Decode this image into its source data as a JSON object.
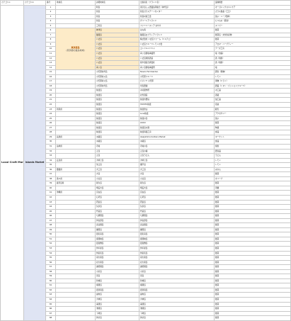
{
  "headers": [
    "カテゴリ①",
    "カテゴリ②",
    "番号",
    "地域名",
    "詳細地域名",
    "出展者名（ブランド名）",
    "業種概要"
  ],
  "category1": "Local Craft Market",
  "category2": "Islands Market",
  "highlight": {
    "title": "東京都島",
    "subtitle": "(東京都の離島地域)"
  },
  "rows": [
    {
      "num": "1",
      "region": "",
      "detail": "利島",
      "name": "東京島しょ農業協同組合（神代島）",
      "desc": "オーガニックスキンケア"
    },
    {
      "num": "2",
      "region": "",
      "detail": "新島",
      "name": "新島ガラスアートセンター",
      "desc": "ガラス製品（工芸）"
    },
    {
      "num": "3",
      "region": "",
      "detail": "新島",
      "name": "新島村商工会",
      "desc": "菓子・ハーブ飲料"
    },
    {
      "num": "4",
      "region": "",
      "detail": "新島",
      "name": "グリーンアイランド",
      "desc": "たべもの（農産）"
    },
    {
      "num": "5",
      "region": "",
      "detail": "三宅島",
      "name": "ファミリーストア みやけ",
      "desc": "スーパー"
    },
    {
      "num": "6",
      "region": "",
      "detail": "神津島",
      "name": "はな香",
      "desc": "雑貨"
    },
    {
      "num": "7",
      "region": "",
      "detail": "御蔵島",
      "name": "御蔵島ロブティアイランド",
      "desc": "雑貨店・文化生産物"
    },
    {
      "num": "8",
      "region": "",
      "detail": "八丈島",
      "name": "株式会社 八丈島ファーム（ドルチェ）",
      "desc": "雑貨"
    },
    {
      "num": "9",
      "region": "",
      "detail": "八丈島",
      "name": "八丈島フルーツレモンの会",
      "desc": "アロマ・ハーブティー"
    },
    {
      "num": "10",
      "region": "",
      "detail": "八丈島",
      "name": "エンドルンドキャ",
      "desc": "チーズ工房"
    },
    {
      "num": "11",
      "region": "",
      "detail": "八丈島",
      "name": "青ヶ島製塩事業所",
      "desc": "塩（食品）"
    },
    {
      "num": "12",
      "region": "",
      "detail": "八丈島",
      "name": "八丈島焼酎酒造",
      "desc": "酒（焼酎）"
    },
    {
      "num": "13",
      "region": "",
      "detail": "八丈島",
      "name": "焼や酒造合資会社",
      "desc": "酒（焼酎）"
    },
    {
      "num": "14",
      "region": "",
      "detail": "青ヶ島",
      "name": "青ヶ島製塩事業所",
      "desc": "塩"
    },
    {
      "num": "15",
      "region": "",
      "detail": "小笠原村母島",
      "name": "Nose's FarmGarden",
      "desc": "農家（果物）"
    },
    {
      "num": "16",
      "region": "",
      "detail": "小笠原村父島",
      "name": "小笠原フルーツ",
      "desc": "レモン"
    },
    {
      "num": "17",
      "region": "",
      "detail": "小笠原村父島",
      "name": "パパイヤ 小笠原",
      "desc": "果物（ドライ）"
    },
    {
      "num": "18",
      "region": "",
      "detail": "小笠原村母島",
      "name": "母島農園",
      "desc": "農業（トマト・パッションフルーツ）"
    },
    {
      "num": "19",
      "region": "",
      "detail": "佐渡島",
      "name": "木村製作所",
      "desc": "木工品"
    },
    {
      "num": "20",
      "region": "",
      "detail": "佐渡島",
      "name": "北雪酒造",
      "desc": "酒蔵"
    },
    {
      "num": "21",
      "region": "",
      "detail": "佐渡島",
      "name": "佐渡市農協",
      "desc": "加工品"
    },
    {
      "num": "22",
      "region": "",
      "detail": "佐渡島",
      "name": "HOSTEL佐渡",
      "desc": "宿泊"
    },
    {
      "num": "23",
      "region": "新潟県",
      "detail": "佐渡島",
      "name": "佐渡金山",
      "desc": "観光"
    },
    {
      "num": "24",
      "region": "",
      "detail": "佐渡島",
      "name": "Luna佐渡",
      "desc": "アクセサリー"
    },
    {
      "num": "25",
      "region": "",
      "detail": "佐渡島",
      "name": "佐渡の島",
      "desc": "菓子"
    },
    {
      "num": "26",
      "region": "",
      "detail": "佐渡島",
      "name": "LIKOU",
      "desc": "雑貨"
    },
    {
      "num": "27",
      "region": "",
      "detail": "佐渡島",
      "name": "佐渡島の器",
      "desc": "陶器"
    },
    {
      "num": "28",
      "region": "",
      "detail": "佐渡島",
      "name": "佐渡海藻工房",
      "desc": "食品"
    },
    {
      "num": "29",
      "region": "兵庫県",
      "detail": "淡路島",
      "name": "Awajishima Soldiers Market",
      "desc": "マーケット"
    },
    {
      "num": "30",
      "region": "",
      "detail": "淡路島",
      "name": "淡路島",
      "desc": "食品"
    },
    {
      "num": "31",
      "region": "長崎県",
      "detail": "壱岐",
      "name": "壱岐の島",
      "desc": "焼酎"
    },
    {
      "num": "32",
      "region": "",
      "detail": "五島",
      "name": "五島の椿",
      "desc": "農産品"
    },
    {
      "num": "33",
      "region": "",
      "detail": "五島",
      "name": "五島うどん",
      "desc": "うどん"
    },
    {
      "num": "34",
      "region": "広島県",
      "detail": "大崎上島",
      "name": "大崎上島",
      "desc": "レモン"
    },
    {
      "num": "35",
      "region": "",
      "detail": "生口島",
      "name": "瀬戸田",
      "desc": "レモン"
    },
    {
      "num": "36",
      "region": "愛媛県",
      "detail": "大三島",
      "name": "大三島",
      "desc": "みかん"
    },
    {
      "num": "37",
      "region": "",
      "detail": "大島",
      "name": "大島",
      "desc": "雑貨"
    },
    {
      "num": "38",
      "region": "香川県",
      "detail": "小豆島",
      "name": "小豆島",
      "desc": "オリーブ"
    },
    {
      "num": "39",
      "region": "鹿児島県",
      "detail": "屋久島",
      "name": "屋久島",
      "desc": "雑貨"
    },
    {
      "num": "40",
      "region": "",
      "detail": "奄美大島",
      "name": "奄美大島",
      "desc": "黒糖"
    },
    {
      "num": "41",
      "region": "沖縄県",
      "detail": "宮古島",
      "name": "宮古島",
      "desc": "雑貨"
    },
    {
      "num": "42",
      "region": "",
      "detail": "石垣島",
      "name": "石垣島",
      "desc": "雑貨"
    },
    {
      "num": "43",
      "region": "",
      "detail": "西表島",
      "name": "西表島",
      "desc": "雑貨"
    },
    {
      "num": "44",
      "region": "",
      "detail": "久米島",
      "name": "久米島",
      "desc": "雑貨"
    },
    {
      "num": "45",
      "region": "",
      "detail": "竹富島",
      "name": "竹富島",
      "desc": "雑貨"
    },
    {
      "num": "46",
      "region": "",
      "detail": "与那国島",
      "name": "与那国島",
      "desc": "雑貨"
    },
    {
      "num": "47",
      "region": "",
      "detail": "伊良部島",
      "name": "伊良部島",
      "desc": "雑貨"
    },
    {
      "num": "48",
      "region": "",
      "detail": "多良間島",
      "name": "多良間島",
      "desc": "雑貨"
    },
    {
      "num": "49",
      "region": "",
      "detail": "粟国島",
      "name": "粟国島",
      "desc": "雑貨"
    },
    {
      "num": "50",
      "region": "",
      "detail": "渡名喜島",
      "name": "渡名喜島",
      "desc": "雑貨"
    },
    {
      "num": "51",
      "region": "",
      "detail": "座間味島",
      "name": "座間味島",
      "desc": "雑貨"
    },
    {
      "num": "52",
      "region": "",
      "detail": "渡嘉敷島",
      "name": "渡嘉敷島",
      "desc": "雑貨"
    },
    {
      "num": "53",
      "region": "",
      "detail": "伊平屋島",
      "name": "伊平屋島",
      "desc": "雑貨"
    },
    {
      "num": "54",
      "region": "",
      "detail": "伊是名島",
      "name": "伊是名島",
      "desc": "雑貨"
    },
    {
      "num": "55",
      "region": "",
      "detail": "南大東島",
      "name": "南大東島",
      "desc": "雑貨"
    },
    {
      "num": "56",
      "region": "",
      "detail": "北大東島",
      "name": "北大東島",
      "desc": "雑貨"
    },
    {
      "num": "57",
      "region": "",
      "detail": "波照間島",
      "name": "波照間島",
      "desc": "雑貨"
    },
    {
      "num": "58",
      "region": "",
      "detail": "小浜島",
      "name": "小浜島",
      "desc": "雑貨"
    },
    {
      "num": "59",
      "region": "",
      "detail": "黒島",
      "name": "黒島",
      "desc": "雑貨"
    },
    {
      "num": "60",
      "region": "",
      "detail": "新城島",
      "name": "新城島",
      "desc": "雑貨"
    },
    {
      "num": "61",
      "region": "",
      "detail": "鳩間島",
      "name": "鳩間島",
      "desc": "雑貨"
    },
    {
      "num": "62",
      "region": "",
      "detail": "嘉弥真島",
      "name": "嘉弥真島",
      "desc": "雑貨"
    },
    {
      "num": "63",
      "region": "",
      "detail": "由布島",
      "name": "由布島",
      "desc": "雑貨"
    },
    {
      "num": "64",
      "region": "",
      "detail": "大神島",
      "name": "大神島",
      "desc": "雑貨"
    },
    {
      "num": "65",
      "region": "",
      "detail": "来間島",
      "name": "来間島",
      "desc": "雑貨"
    },
    {
      "num": "66",
      "region": "",
      "detail": "池間島",
      "name": "池間島",
      "desc": "雑貨"
    },
    {
      "num": "67",
      "region": "",
      "detail": "下地島",
      "name": "下地島",
      "desc": "雑貨"
    },
    {
      "num": "68",
      "region": "",
      "detail": "伊計島",
      "name": "伊計島",
      "desc": "雑貨"
    }
  ]
}
